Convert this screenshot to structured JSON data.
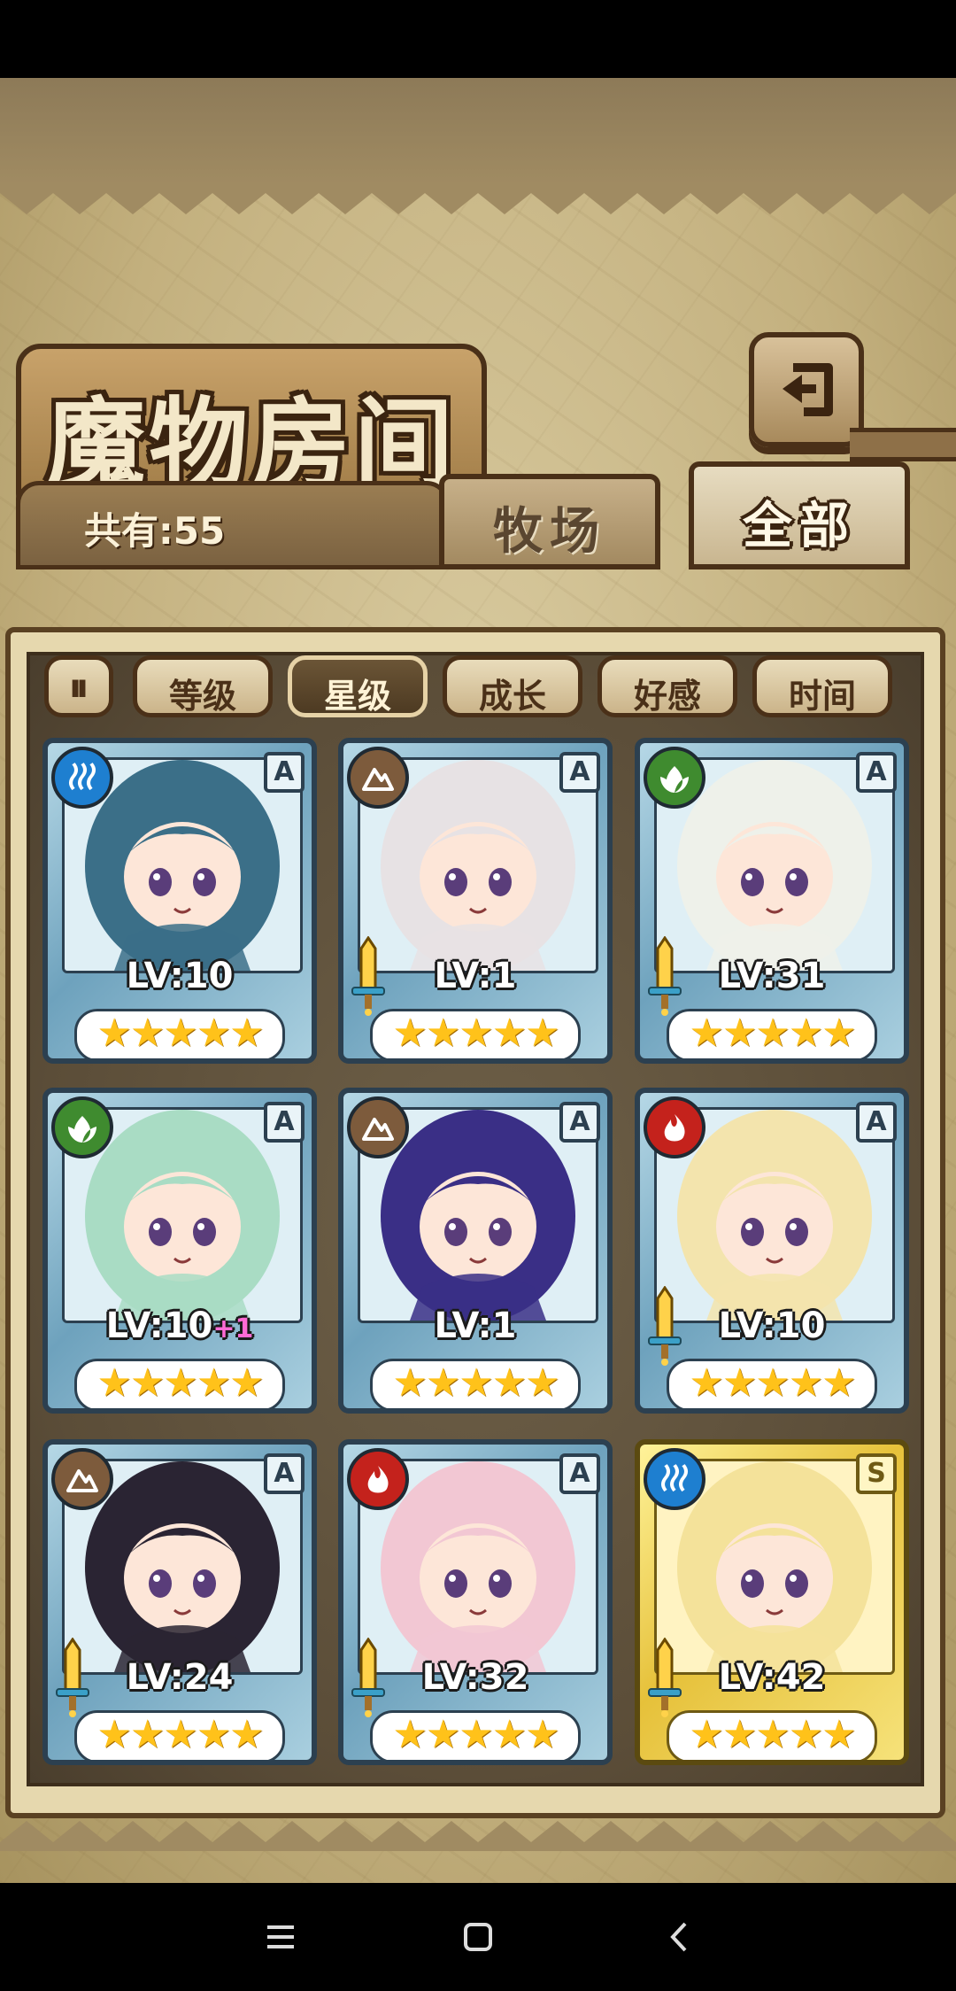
{
  "screen": {
    "title": "魔物房间",
    "count_label": "共有:55",
    "tabs": [
      {
        "label": "牧场",
        "active": false
      },
      {
        "label": "全部",
        "active": true
      }
    ],
    "sort_buttons": [
      {
        "label": "等级",
        "active": false
      },
      {
        "label": "星级",
        "active": true
      },
      {
        "label": "成长",
        "active": false
      },
      {
        "label": "好感",
        "active": false
      },
      {
        "label": "时间",
        "active": false
      }
    ],
    "sort_toggle_label": "⏸"
  },
  "monsters": [
    {
      "level": "LV:10",
      "bonus": "",
      "rank": "A",
      "element": "water",
      "stars": "★★★★★",
      "star_count": 5,
      "equipped": false,
      "frame": "blue",
      "hair": "#3b6f88"
    },
    {
      "level": "LV:1",
      "bonus": "",
      "rank": "A",
      "element": "earth",
      "stars": "★★★★★",
      "star_count": 5,
      "equipped": true,
      "frame": "blue",
      "hair": "#e7e2e4"
    },
    {
      "level": "LV:31",
      "bonus": "",
      "rank": "A",
      "element": "wood",
      "stars": "★★★★★",
      "star_count": 5,
      "equipped": true,
      "frame": "blue",
      "hair": "#eef1ea"
    },
    {
      "level": "LV:10",
      "bonus": "+1",
      "rank": "A",
      "element": "wood",
      "stars": "★★★★★",
      "star_count": 5,
      "equipped": false,
      "frame": "blue",
      "hair": "#a9dcc4"
    },
    {
      "level": "LV:1",
      "bonus": "",
      "rank": "A",
      "element": "earth",
      "stars": "★★★★★",
      "star_count": 5,
      "equipped": false,
      "frame": "blue",
      "hair": "#3a2f86"
    },
    {
      "level": "LV:10",
      "bonus": "",
      "rank": "A",
      "element": "fire",
      "stars": "★★★★★",
      "star_count": 5,
      "equipped": true,
      "frame": "blue",
      "hair": "#f3e4ad"
    },
    {
      "level": "LV:24",
      "bonus": "",
      "rank": "A",
      "element": "earth",
      "stars": "★★★★★",
      "star_count": 5,
      "equipped": true,
      "frame": "blue",
      "hair": "#2a2433"
    },
    {
      "level": "LV:32",
      "bonus": "",
      "rank": "A",
      "element": "fire",
      "stars": "★★★★★",
      "star_count": 5,
      "equipped": true,
      "frame": "blue",
      "hair": "#f2c7d3"
    },
    {
      "level": "LV:42",
      "bonus": "",
      "rank": "S",
      "element": "water",
      "stars": "★★★★★",
      "star_count": 5,
      "equipped": true,
      "frame": "gold",
      "hair": "#f4e29a"
    }
  ],
  "nav": {
    "menu_icon": "menu-icon",
    "home_icon": "home-icon",
    "back_icon": "back-arrow-icon"
  }
}
